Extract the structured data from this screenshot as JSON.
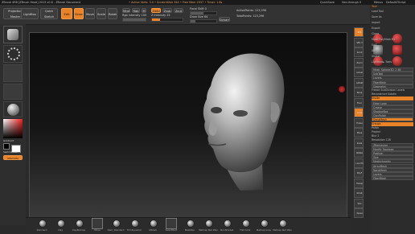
{
  "window": {
    "title": "ZBrush 4R6 [ZBrush Head] 2013 v0.6 - ZBrush Document",
    "center_info": "• Active Verts: 3.0 • ScratchDisk 344 • Free Mem 2937 • Timer: 1.8s",
    "menus": [
      "Alpha",
      "Brush",
      "Color",
      "Document",
      "Draw",
      "Edit",
      "File",
      "Layer",
      "Light",
      "Macro",
      "Marker",
      "Material",
      "Movie",
      "Picker",
      "Preferences",
      "Render",
      "Stencil",
      "Stroke",
      "Texture",
      "Tool",
      "Transform",
      "Zplugin",
      "Zscript"
    ],
    "right_info": [
      "QuickSave",
      "See-through 0",
      "Menus",
      "DefaultZScript"
    ]
  },
  "shelf": {
    "projection_master": "Projection Master",
    "lightbox": "LightBox",
    "quick_sketch": "Quick Sketch",
    "edit": "Edit",
    "draw": "Draw",
    "move": "Move",
    "scale": "Scale",
    "rotate": "Rotate",
    "mrgb": "Mrgb",
    "rgb": "Rgb",
    "m": "M",
    "zadd": "Zadd",
    "zsub": "Zsub",
    "zcut": "Zcut",
    "rgb_intensity_label": "Rgb Intensity",
    "rgb_intensity_value": 100,
    "z_intensity_label": "Z Intensity",
    "z_intensity_value": 25,
    "focal_shift_label": "Focal Shift",
    "focal_shift_value": 0,
    "draw_size_label": "Draw Size",
    "draw_size_value": 64,
    "dynamic": "Dynamic",
    "active_points": "ActivePoints: 123,296",
    "total_points": "TotalPoints: 123,296"
  },
  "left_shelf": {
    "gradient_label": "Gradient",
    "switch_color": "SwitchColor",
    "alternate": "Alternate"
  },
  "right_tray": {
    "items": [
      {
        "label": "Load Tool",
        "type": "button"
      },
      {
        "label": "Save As",
        "type": "button"
      },
      {
        "label": "Import",
        "type": "button"
      },
      {
        "label": "Export",
        "type": "button"
      },
      {
        "label": "Clone",
        "type": "button"
      },
      {
        "label": "Make PolyMesh3D",
        "type": "button"
      },
      {
        "label": "GoZ",
        "type": "button"
      },
      {
        "label": "All",
        "type": "button"
      },
      {
        "label": "Visible",
        "type": "button"
      },
      {
        "label": "Lightbox► Tools",
        "type": "button"
      },
      {
        "label": "Mesh_Sphere3D_2 48",
        "type": "header"
      },
      {
        "label": "SubTool",
        "type": "header"
      },
      {
        "label": "Layers",
        "type": "header"
      },
      {
        "label": "FiberMesh",
        "type": "header"
      },
      {
        "label": "Geometry",
        "type": "header"
      },
      {
        "label": "Freeze SubDivision Levels",
        "type": "button"
      },
      {
        "label": "Reconstruct Subdiv",
        "type": "button"
      },
      {
        "label": "Divide",
        "type": "button"
      },
      {
        "label": "Edge Loop",
        "type": "header"
      },
      {
        "label": "Crease",
        "type": "header"
      },
      {
        "label": "ShadowBox",
        "type": "header"
      },
      {
        "label": "ClayPolish",
        "type": "header"
      },
      {
        "label": "DynaMesh",
        "type": "header"
      },
      {
        "label": "Groups",
        "type": "button"
      },
      {
        "label": "Polish",
        "type": "button"
      },
      {
        "label": "Project",
        "type": "button"
      },
      {
        "label": "Blur 2",
        "type": "button"
      },
      {
        "label": "Resolution 128",
        "type": "button"
      },
      {
        "label": "ZRemesher",
        "type": "header"
      },
      {
        "label": "Modify Topology",
        "type": "header"
      },
      {
        "label": "Position",
        "type": "header"
      },
      {
        "label": "Size",
        "type": "header"
      },
      {
        "label": "MeshIntegrity",
        "type": "header"
      },
      {
        "label": "ArrayMesh",
        "type": "header"
      },
      {
        "label": "NanoMesh",
        "type": "header"
      },
      {
        "label": "Layers",
        "type": "header"
      },
      {
        "label": "FiberMesh",
        "type": "header"
      }
    ],
    "tool_title": "Tool",
    "thumb_labels": [
      "Mesh_Sphere3D",
      "PolyMesh3D",
      "SimpleBrush",
      "Mesh_Sphere3D"
    ]
  },
  "right_shelf_buttons": [
    "BPR",
    "SPix 3",
    "Scroll",
    "Zoom",
    "Actual",
    "AAHalf",
    "Persp",
    "Floor",
    "Local",
    "Frame",
    "Move",
    "Scale",
    "Rotate",
    "Line Fill",
    "PolyF",
    "Transp",
    "Ghost",
    "Solo",
    "Xpose"
  ],
  "bottom_shelf": {
    "items": [
      {
        "label": "Standard",
        "kind": "brush"
      },
      {
        "label": "Clay",
        "kind": "brush"
      },
      {
        "label": "ClayBuildup",
        "kind": "brush"
      },
      {
        "label": "Move",
        "kind": "box"
      },
      {
        "label": "Dam_Standard",
        "kind": "brush"
      },
      {
        "label": "TrimDynamic",
        "kind": "brush"
      },
      {
        "label": "hPolish",
        "kind": "brush"
      },
      {
        "label": "SelectRect",
        "kind": "box"
      },
      {
        "label": "MaskPen",
        "kind": "brush"
      },
      {
        "label": "MatCap Red Wax",
        "kind": "brush"
      },
      {
        "label": "SkinShade4",
        "kind": "brush"
      },
      {
        "label": "Flat Color",
        "kind": "brush"
      },
      {
        "label": "MatCap Gray",
        "kind": "brush"
      },
      {
        "label": "MatCap Red Wax",
        "kind": "brush"
      }
    ]
  },
  "colors": {
    "accent": "#e8832a",
    "bg": "#2a2a2a",
    "canvas_top": "#0d0d0d",
    "canvas_bottom": "#3c3c3c"
  }
}
